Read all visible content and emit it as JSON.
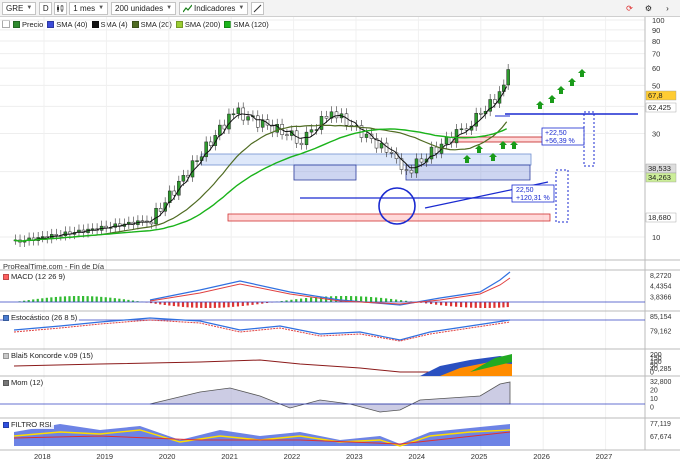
{
  "toolbar": {
    "symbol": "GRE",
    "mode_label": "D",
    "period": "1 mes",
    "units": "200 unidades",
    "indicators": "Indicadores"
  },
  "legend": [
    {
      "label": "Precio",
      "color": "#2e8b2e"
    },
    {
      "label": "SMA (40)",
      "color": "#3b4bd8"
    },
    {
      "label": "SMA (4)",
      "color": "#111111"
    },
    {
      "label": "SMA (20)",
      "color": "#4f6b22"
    },
    {
      "label": "SMA (200)",
      "color": "#9acd32"
    },
    {
      "label": "SMA (120)",
      "color": "#1ab31a"
    }
  ],
  "source_label": "ProRealTime.com - Fin de Día",
  "panels": {
    "macd": {
      "title": "MACD (12 26 9)",
      "color": "#ff6060",
      "labels": [
        "8,2720",
        "4,4354",
        "3,8366"
      ]
    },
    "stoch": {
      "title": "Estocástico (26 8 5)",
      "color": "#4a7bd0",
      "labels": [
        "85,154",
        "79,162"
      ]
    },
    "blai": {
      "title": "Blai5 Koncorde v.09 (15)",
      "color": "#c8c8c8",
      "labels": [
        "200",
        "150",
        "100",
        "50",
        "40,285",
        "0"
      ]
    },
    "mom": {
      "title": "Mom (12)",
      "color": "#777777",
      "labels": [
        "32,800",
        "20",
        "10",
        "0"
      ]
    },
    "rsi": {
      "title": "FILTRO RSI",
      "color": "#3050e0",
      "labels": [
        "77,119",
        "67,674"
      ]
    }
  },
  "annotations": {
    "box_pct_1": "+22,50",
    "box_pct_2": "+56,39 %",
    "box_low_1": "22,50",
    "box_low_2": "+120,31 %"
  },
  "chart_data": {
    "type": "candlestick",
    "x_ticks": [
      "2018",
      "2019",
      "2020",
      "2021",
      "2022",
      "2023",
      "2024",
      "2025",
      "2026",
      "2027"
    ],
    "y_ticks": [
      "100",
      "90",
      "80",
      "70",
      "60",
      "50",
      "40",
      "30",
      "20",
      "10"
    ],
    "y_scale": "log",
    "ylim": [
      8,
      100
    ],
    "price_labels": [
      {
        "text": "67,8",
        "bg": "#ffcc33"
      },
      {
        "text": "62,425",
        "bg": "#ffffff"
      },
      {
        "text": "38,533",
        "bg": "#dddddd"
      },
      {
        "text": "34,263",
        "bg": "#ccee99"
      },
      {
        "text": "18,680",
        "bg": "#ffffff"
      }
    ]
  }
}
